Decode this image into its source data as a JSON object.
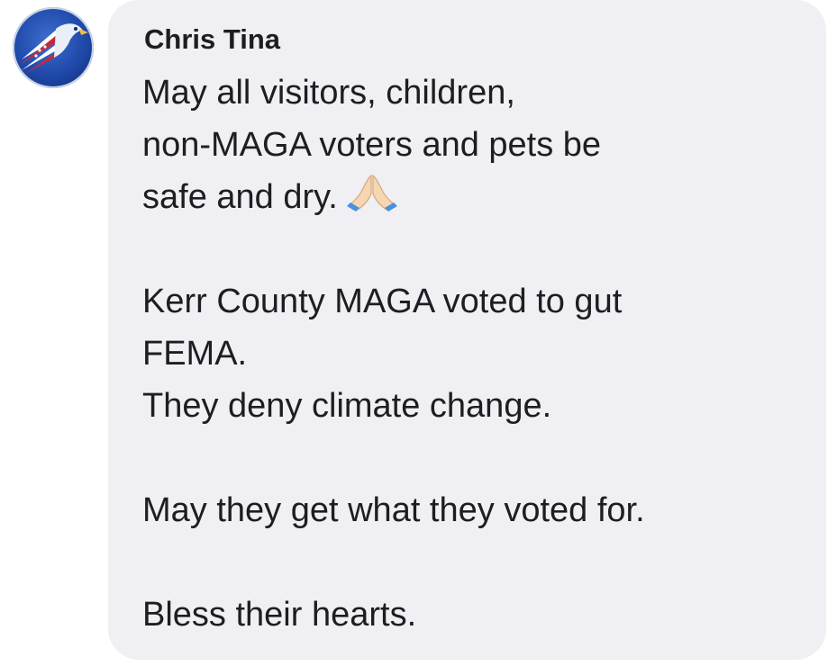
{
  "comment": {
    "author": "Chris Tina",
    "avatar_icon": "eagle-flag-icon",
    "paragraphs": [
      {
        "lines": [
          "May all visitors, children,",
          "non-MAGA voters and pets be",
          "safe and dry."
        ],
        "trailing_emoji": "folded-hands-emoji"
      },
      {
        "lines": [
          "Kerr County MAGA voted to gut",
          "FEMA.",
          "They deny climate change."
        ]
      },
      {
        "lines": [
          "May they get what they voted for."
        ]
      },
      {
        "lines": [
          "Bless their hearts."
        ]
      }
    ]
  },
  "colors": {
    "bubble_bg": "#efeff4",
    "text": "#1c1e21",
    "avatar_blue": "#1f48a8",
    "flag_red": "#c8283c"
  }
}
